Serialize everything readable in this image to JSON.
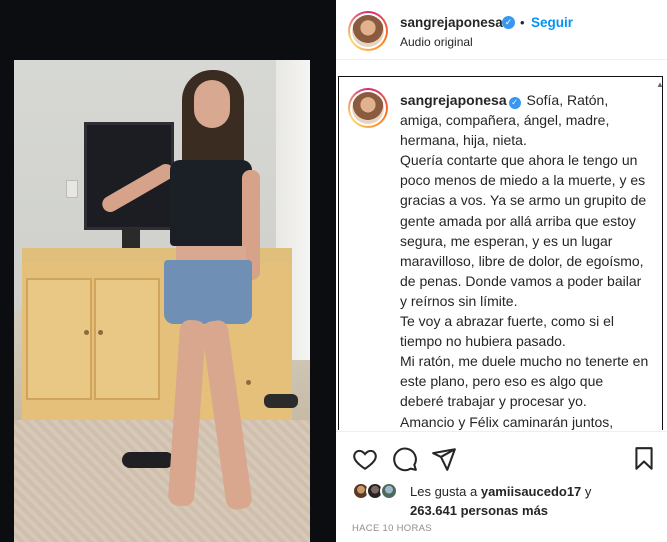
{
  "post": {
    "username": "sangrejaponesa",
    "separator": "•",
    "follow_label": "Seguir",
    "audio_label": "Audio original"
  },
  "caption": {
    "username": "sangrejaponesa",
    "text": "Sofía, Ratón, amiga, compañera, ángel, madre, hermana, hija, nieta.\nQuería contarte que ahora le tengo un poco menos de miedo a la muerte, y es gracias a vos. Ya se armo un grupito de gente amada por allá arriba que estoy segura, me esperan, y es un lugar maravilloso, libre de dolor, de egoísmo, de penas. Donde vamos a poder bailar y reírnos sin límite.\nTe voy a abrazar fuerte, como si el tiempo no hubiera pasado.\nMi ratón, me duele mucho no tenerte en este plano, pero eso es algo que deberé trabajar y procesar yo.\nAmancio y Félix caminarán juntos, seguro sean muy buenos amigos, ya vas a ver. Cuando puedas pásate un"
  },
  "likes": {
    "prefix": "Les gusta a",
    "user": "yamiisaucedo17",
    "connector": "y",
    "count": "263.641 personas más"
  },
  "timestamp": "HACE 10 HORAS",
  "icons": {
    "like": "heart-icon",
    "comment": "comment-icon",
    "share": "paper-plane-icon",
    "save": "bookmark-icon",
    "verified": "verified-badge-icon"
  },
  "colors": {
    "accent": "#0095f6",
    "verified": "#3897f0",
    "text": "#262626",
    "muted": "#8e8e8e"
  }
}
